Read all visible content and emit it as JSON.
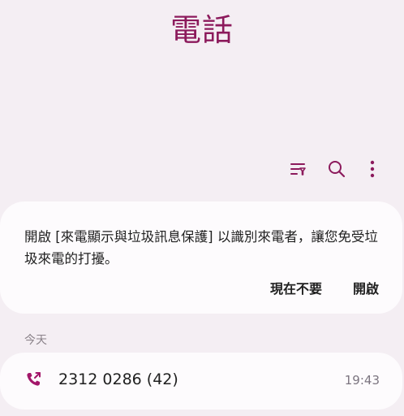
{
  "app": {
    "title": "電話"
  },
  "toolbar": {
    "filter_icon": "filter-icon",
    "search_icon": "search-icon",
    "more_icon": "more-vert-icon"
  },
  "spam_banner": {
    "message": "開啟 [來電顯示與垃圾訊息保護] 以識別來電者，讓您免受垃圾來電的打擾。",
    "dismiss_label": "現在不要",
    "enable_label": "開啟"
  },
  "recents": {
    "section_label": "今天",
    "items": [
      {
        "number": "2312 0286 (42)",
        "time": "19:43",
        "icon": "outgoing-call-icon"
      }
    ]
  },
  "colors": {
    "accent": "#8c1a5c",
    "background": "#f4eef3",
    "card": "#fdfbfd"
  }
}
